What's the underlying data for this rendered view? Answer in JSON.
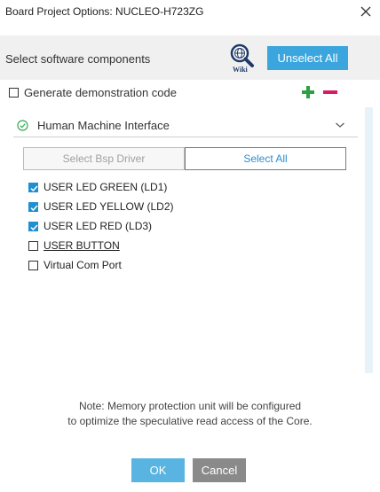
{
  "window": {
    "title": "Board Project Options: NUCLEO-H723ZG",
    "close_icon": "close-icon"
  },
  "toolbar": {
    "label": "Select software components",
    "wiki_icon": "wiki-search-icon",
    "wiki_text": "Wiki",
    "unselect_all_label": "Unselect All"
  },
  "options": {
    "generate_demo_label": "Generate demonstration code",
    "generate_demo_checked": false,
    "add_icon": "plus-icon",
    "remove_icon": "minus-icon",
    "add_color": "#2ea043",
    "remove_color": "#d81b60"
  },
  "section": {
    "title": "Human Machine Interface",
    "status_icon": "check-circle-icon",
    "status_color": "#34a853",
    "expand_icon": "chevron-down-icon"
  },
  "drivers": {
    "select_bsp_label": "Select Bsp Driver",
    "select_all_label": "Select All"
  },
  "components": [
    {
      "label": "USER LED GREEN (LD1)",
      "checked": true
    },
    {
      "label": "USER LED YELLOW (LD2)",
      "checked": true
    },
    {
      "label": "USER LED RED (LD3)",
      "checked": true
    },
    {
      "label": "USER BUTTON",
      "checked": false
    },
    {
      "label": "Virtual Com Port",
      "checked": false
    }
  ],
  "note": {
    "line1": "Note: Memory protection unit will be configured",
    "line2": "to optimize the speculative read access of the Core."
  },
  "footer": {
    "ok_label": "OK",
    "cancel_label": "Cancel"
  },
  "colors": {
    "accent": "#3aa6dd",
    "ok_button": "#5ab4e1",
    "cancel_button": "#8a8a8a",
    "checkbox_checked": "#1f8fd0"
  }
}
